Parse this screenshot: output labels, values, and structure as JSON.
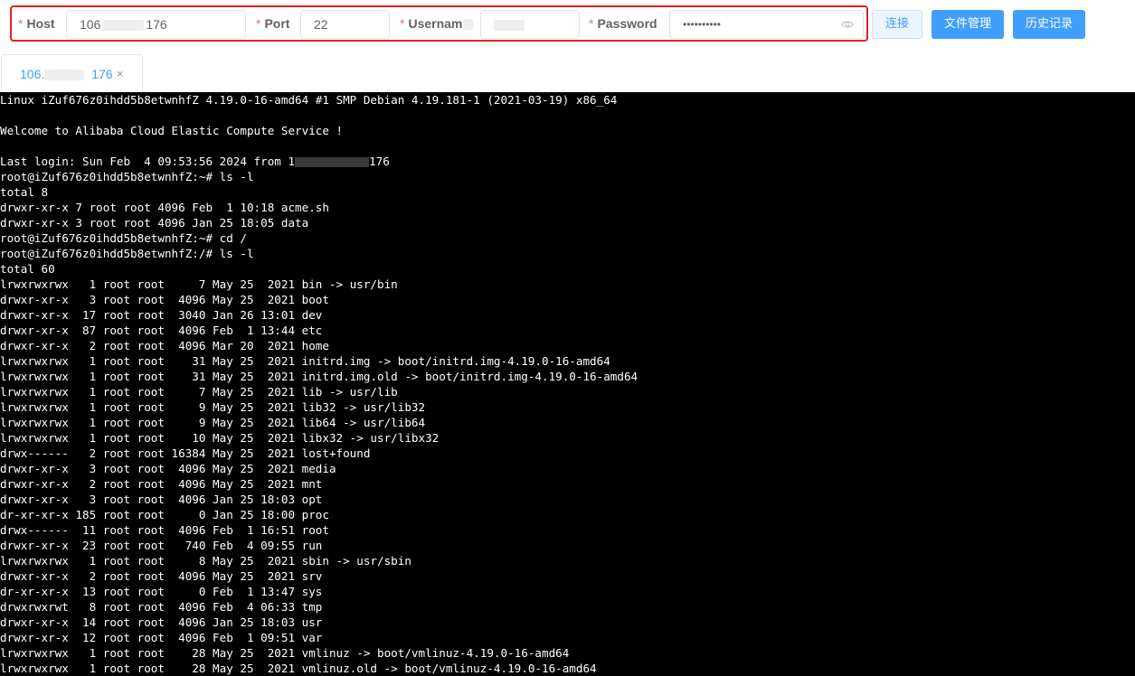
{
  "connection": {
    "host_label": "Host",
    "host_value_prefix": "106",
    "host_value_suffix": "176",
    "port_label": "Port",
    "port_value": "22",
    "username_label": "Usernam",
    "password_label": "Password",
    "password_value": "••••••••••",
    "required_mark": "*",
    "eye_icon": "eye-icon"
  },
  "buttons": {
    "connect": "连接",
    "file_manager": "文件管理",
    "history": "历史记录"
  },
  "colors": {
    "accent": "#409eff",
    "highlight_border": "#e02020",
    "required": "#f56c6c",
    "terminal_bg": "#000000",
    "terminal_fg": "#ffffff"
  },
  "tabs": [
    {
      "label_prefix": "106.",
      "label_suffix": "176",
      "close": "×"
    }
  ],
  "terminal": {
    "lines": [
      "Linux iZuf676z0ihdd5b8etwnhfZ 4.19.0-16-amd64 #1 SMP Debian 4.19.181-1 (2021-03-19) x86_64",
      "",
      "Welcome to Alibaba Cloud Elastic Compute Service !",
      "",
      "Last login: Sun Feb  4 09:53:56 2024 from 1",
      "root@iZuf676z0ihdd5b8etwnhfZ:~# ls -l",
      "total 8",
      "drwxr-xr-x 7 root root 4096 Feb  1 10:18 acme.sh",
      "drwxr-xr-x 3 root root 4096 Jan 25 18:05 data",
      "root@iZuf676z0ihdd5b8etwnhfZ:~# cd /",
      "root@iZuf676z0ihdd5b8etwnhfZ:/# ls -l",
      "total 60",
      "lrwxrwxrwx   1 root root     7 May 25  2021 bin -> usr/bin",
      "drwxr-xr-x   3 root root  4096 May 25  2021 boot",
      "drwxr-xr-x  17 root root  3040 Jan 26 13:01 dev",
      "drwxr-xr-x  87 root root  4096 Feb  1 13:44 etc",
      "drwxr-xr-x   2 root root  4096 Mar 20  2021 home",
      "lrwxrwxrwx   1 root root    31 May 25  2021 initrd.img -> boot/initrd.img-4.19.0-16-amd64",
      "lrwxrwxrwx   1 root root    31 May 25  2021 initrd.img.old -> boot/initrd.img-4.19.0-16-amd64",
      "lrwxrwxrwx   1 root root     7 May 25  2021 lib -> usr/lib",
      "lrwxrwxrwx   1 root root     9 May 25  2021 lib32 -> usr/lib32",
      "lrwxrwxrwx   1 root root     9 May 25  2021 lib64 -> usr/lib64",
      "lrwxrwxrwx   1 root root    10 May 25  2021 libx32 -> usr/libx32",
      "drwx------   2 root root 16384 May 25  2021 lost+found",
      "drwxr-xr-x   3 root root  4096 May 25  2021 media",
      "drwxr-xr-x   2 root root  4096 May 25  2021 mnt",
      "drwxr-xr-x   3 root root  4096 Jan 25 18:03 opt",
      "dr-xr-xr-x 185 root root     0 Jan 25 18:00 proc",
      "drwx------  11 root root  4096 Feb  1 16:51 root",
      "drwxr-xr-x  23 root root   740 Feb  4 09:55 run",
      "lrwxrwxrwx   1 root root     8 May 25  2021 sbin -> usr/sbin",
      "drwxr-xr-x   2 root root  4096 May 25  2021 srv",
      "dr-xr-xr-x  13 root root     0 Feb  1 13:47 sys",
      "drwxrwxrwt   8 root root  4096 Feb  4 06:33 tmp",
      "drwxr-xr-x  14 root root  4096 Jan 25 18:03 usr",
      "drwxr-xr-x  12 root root  4096 Feb  1 09:51 var",
      "lrwxrwxrwx   1 root root    28 May 25  2021 vmlinuz -> boot/vmlinuz-4.19.0-16-amd64",
      "lrwxrwxrwx   1 root root    28 May 25  2021 vmlinuz.old -> boot/vmlinuz-4.19.0-16-amd64"
    ],
    "last_login_ip_suffix": "176"
  }
}
